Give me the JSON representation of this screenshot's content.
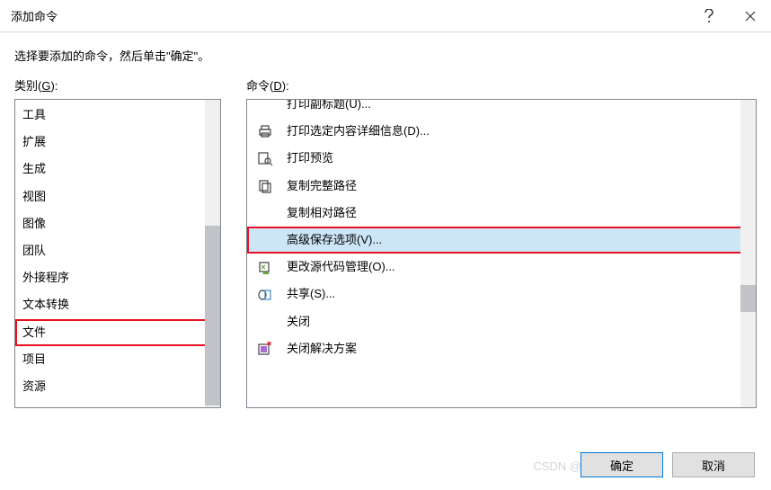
{
  "titlebar": {
    "title": "添加命令"
  },
  "instruction": "选择要添加的命令，然后单击\"确定\"。",
  "labels": {
    "category_prefix": "类别(",
    "category_ak": "G",
    "category_suffix": "):",
    "commands_prefix": "命令(",
    "commands_ak": "D",
    "commands_suffix": "):"
  },
  "categories": [
    {
      "label": "工具"
    },
    {
      "label": "扩展"
    },
    {
      "label": "生成"
    },
    {
      "label": "视图"
    },
    {
      "label": "图像"
    },
    {
      "label": "团队"
    },
    {
      "label": "外接程序"
    },
    {
      "label": "文本转换"
    },
    {
      "label": "文件",
      "highlight": true
    },
    {
      "label": "项目"
    },
    {
      "label": "资源"
    }
  ],
  "commands": [
    {
      "label": "打印副标题(U)...",
      "icon": "none",
      "partial_top": true
    },
    {
      "label": "打印选定内容详细信息(D)...",
      "icon": "print"
    },
    {
      "label": "打印预览",
      "icon": "preview"
    },
    {
      "label": "复制完整路径",
      "icon": "copy"
    },
    {
      "label": "复制相对路径",
      "icon": "none"
    },
    {
      "label": "高级保存选项(V)...",
      "icon": "none",
      "selected": true,
      "highlight": true
    },
    {
      "label": "更改源代码管理(O)...",
      "icon": "scm"
    },
    {
      "label": "共享(S)...",
      "icon": "share"
    },
    {
      "label": "关闭",
      "icon": "none"
    },
    {
      "label": "关闭解决方案",
      "icon": "close-sln"
    }
  ],
  "buttons": {
    "ok": "确定",
    "cancel": "取消"
  },
  "watermark": "CSDN @失去梦想的小草"
}
